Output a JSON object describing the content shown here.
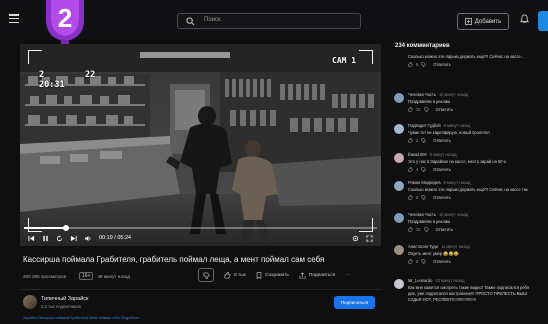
{
  "header": {
    "badge_number": "2",
    "search_placeholder": "Поиск",
    "add_button_label": "Добавить",
    "accent": "#1e88e5"
  },
  "video": {
    "date_overlay": "2        22",
    "time_overlay": "20:31",
    "cam_label": "CAM 1",
    "current_time": "00:19 / 05:24",
    "progress_fraction": 0.12,
    "title": "Кассирша поймала Грабителя, грабитель поймал леща, а мент поймал сам себя",
    "views": "200 290 просмотров",
    "age": "49 минут назад",
    "tag_icon": "16+",
    "actions": {
      "likes": "8 тыс",
      "save": "Сохранить",
      "share": "Поделиться",
      "more": "···"
    }
  },
  "channel": {
    "name": "Типичный Зарайск",
    "subscribers": "3,2 тыс подписчиков",
    "subscribe_label": "Подписаться",
    "footer_text": "Зарайск Кассирша поймала Грабителя Мент поймал себя Подробнее"
  },
  "comments": {
    "count_label": "234 комментариев",
    "items": [
      {
        "author": "",
        "time": "",
        "text": "Сколько можно эти ларьки держать ещё?! Сейчас на кассе...",
        "likes": "6",
        "reply": "Ответить",
        "color": "#6b7a88"
      },
      {
        "author": "Человек Часть",
        "time": "10 минут назад",
        "text": "Поздравляю в реклам",
        "likes": "22",
        "reply": "Ответить",
        "color": "#7f9bb5"
      },
      {
        "author": "Подводит Гудбой",
        "time": "8 минут назад",
        "text": "Чувак тот не карелфирую, новый пролетел",
        "likes": "2",
        "reply": "Ответить",
        "color": "#a3b8cc"
      },
      {
        "author": "Ёжик1000",
        "time": "9 минут назад",
        "text": "Это у нас в Зарайске на кассе, место зарай на 50-х",
        "likes": "4",
        "reply": "Ответить",
        "color": "#c7a7b8"
      },
      {
        "author": "Роман Медведев",
        "time": "9 минут назад",
        "text": "Сколько можно эти ларьки держать ещё?! Сейчас на кассе так",
        "likes": "6",
        "reply": "Ответить",
        "color": "#8fa7bf"
      },
      {
        "author": "Человек Часть",
        "time": "10 минут назад",
        "text": "Поздравляю в реклам",
        "likes": "22",
        "reply": "Ответить",
        "color": "#7f9bb5"
      },
      {
        "author": "Анастасия Туди",
        "time": "11 минут назад",
        "text": "Охуеть мент умер 😂😂😂",
        "likes": "6",
        "reply": "Ответить",
        "color": "#9c8f7f"
      },
      {
        "author": "Mr_Leonardo",
        "time": "13 минут назад",
        "text": "Как мне кажется смотреть такие видео! Также подписался ребя",
        "text2": "дие, уже подписался настроение!!! ПРОСТО ПРЕЛЕСТЬ ВЫШ",
        "text3": "СУДЬЯ НОТ, РЕСПЕКТ!!!!!!!!!!!!!!!!!!!!!",
        "likes": "",
        "reply": "",
        "color": "#c7c7d0"
      }
    ]
  }
}
